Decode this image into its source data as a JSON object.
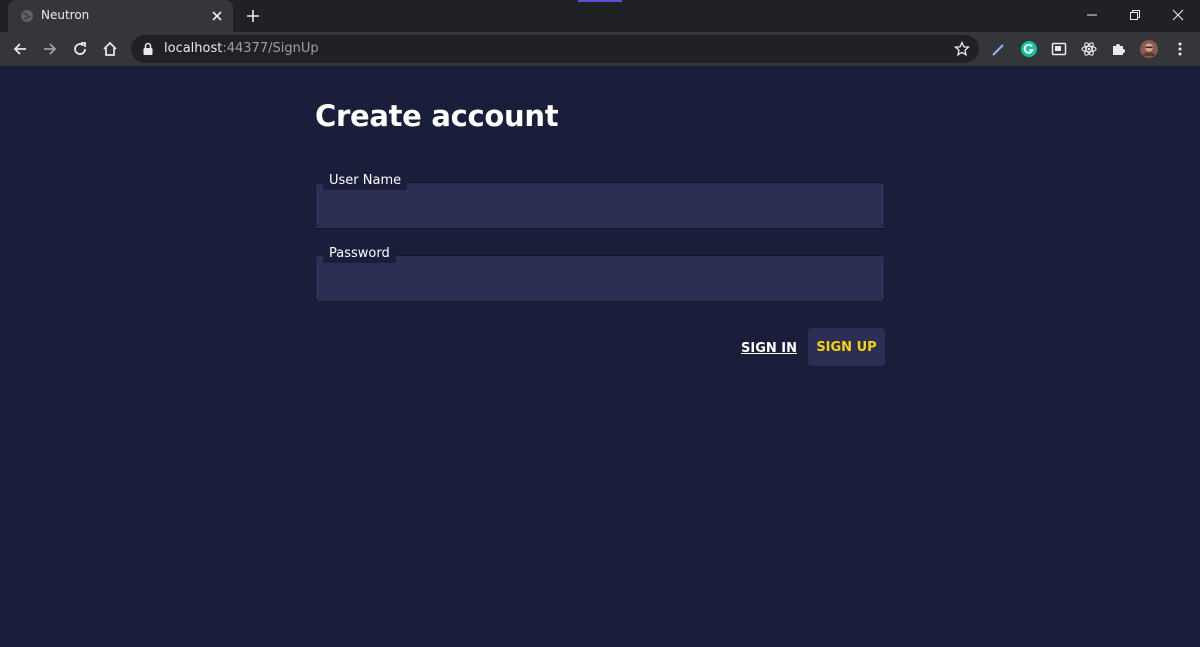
{
  "browser": {
    "tab": {
      "title": "Neutron"
    },
    "address_bar": {
      "host": "localhost",
      "rest": ":44377/SignUp"
    }
  },
  "form": {
    "title": "Create account",
    "username": {
      "label": "User Name",
      "value": ""
    },
    "password": {
      "label": "Password",
      "value": ""
    },
    "signin_label": "SIGN IN",
    "signup_label": "SIGN UP"
  },
  "colors": {
    "page_background": "#1b1e3a",
    "field_background": "#2c2f54",
    "signup_text": "#f5d30f"
  },
  "icons": [
    "globe-icon",
    "close-icon",
    "plus-icon",
    "minimize-icon",
    "restore-icon",
    "back-arrow-icon",
    "forward-arrow-icon",
    "reload-icon",
    "home-icon",
    "lock-icon",
    "star-icon",
    "pen-extension-icon",
    "grammarly-icon",
    "media-icon",
    "react-devtools-icon",
    "puzzle-icon",
    "profile-avatar",
    "menu-dots-icon"
  ]
}
